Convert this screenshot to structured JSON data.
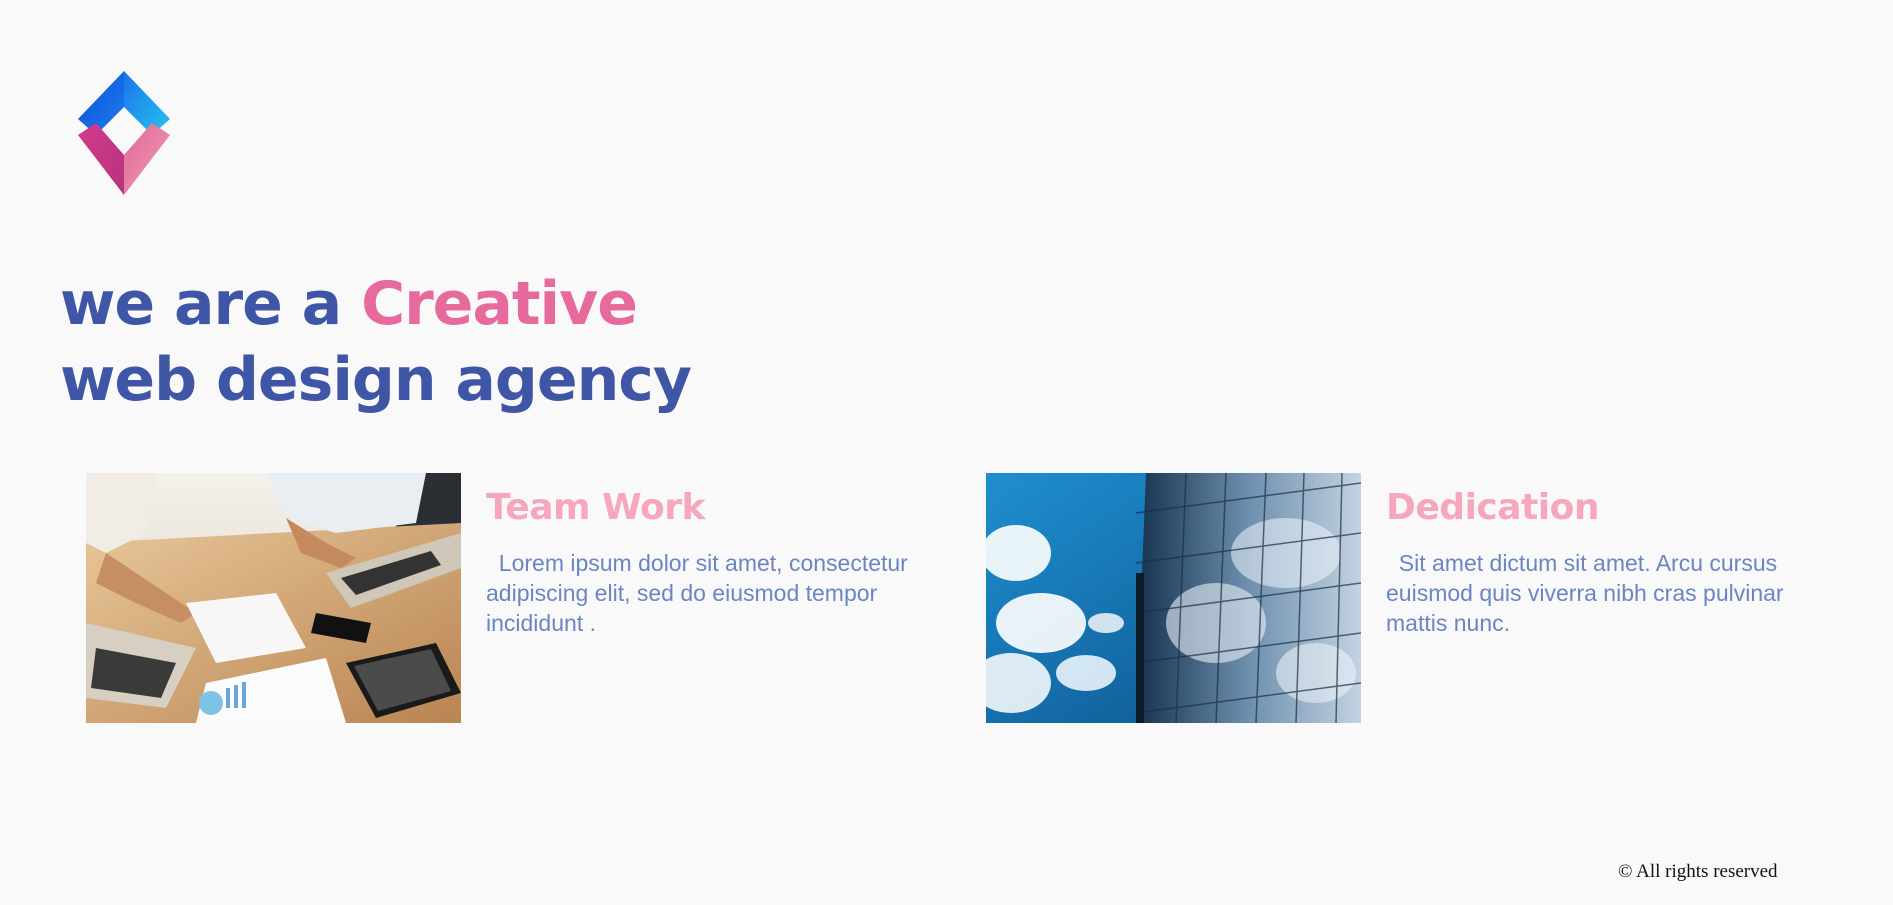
{
  "brand": {
    "logo_icon": "diamond-logo-icon",
    "colors": {
      "logo_top": "#1a6fe0",
      "logo_bottom": "#d84d8e",
      "headline": "#3f55a6",
      "headline_accent": "#e66a9e",
      "card_title": "#f6a7bc",
      "card_text": "#6a85c4",
      "background": "#f9f9f9"
    }
  },
  "hero": {
    "line1_prefix": "we are a ",
    "line1_accent": "Creative",
    "line2": "web design agency"
  },
  "features": [
    {
      "title": "Team Work",
      "description": "Lorem ipsum dolor sit amet, consectetur adipiscing elit, sed do eiusmod tempor incididunt .",
      "image": "teamwork-photo"
    },
    {
      "title": "Dedication",
      "description": "Sit amet dictum sit amet. Arcu cursus euismod quis viverra nibh cras pulvinar mattis nunc.",
      "image": "glass-building-sky-photo"
    }
  ],
  "footer": {
    "copyright": "© All rights reserved"
  }
}
